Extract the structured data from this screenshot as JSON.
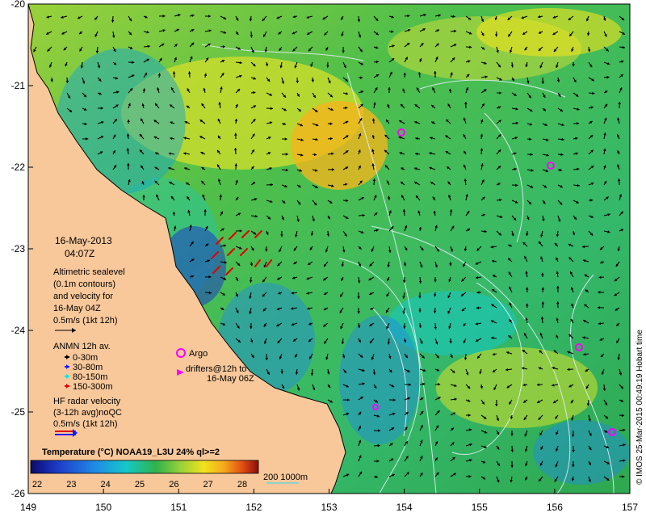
{
  "map": {
    "x_ticks": [
      "149",
      "150",
      "151",
      "152",
      "153",
      "154",
      "155",
      "156",
      "157"
    ],
    "y_ticks": [
      "-20",
      "-21",
      "-22",
      "-23",
      "-24",
      "-25",
      "-26"
    ],
    "timestamp": {
      "date": "16-May-2013",
      "time": "04:07Z"
    },
    "altimetry_text": [
      "Altimetric sealevel",
      "(0.1m contours)",
      "and velocity for",
      "16-May 04Z"
    ],
    "altimetry_scale": "0.5m/s (1kt 12h)",
    "anmn": {
      "title": "ANMN 12h av.",
      "items": [
        {
          "label": "0-30m",
          "color": "#000000"
        },
        {
          "label": "30-80m",
          "color": "#1a1aff"
        },
        {
          "label": "80-150m",
          "color": "#00e5e5"
        },
        {
          "label": "150-300m",
          "color": "#e60000"
        }
      ]
    },
    "argo_label": "Argo",
    "drifters_text": [
      "drifters@12h to",
      "16-May 06Z"
    ],
    "hf_text": [
      "HF radar velocity",
      "(3-12h avg)noQC",
      "0.5m/s (1kt 12h)"
    ],
    "colorbar_title": "Temperature (°C) NOAA19_L3U 24% ql>=2",
    "colorbar_ticks": [
      "22",
      "23",
      "24",
      "25",
      "26",
      "27",
      "28"
    ],
    "colorbar_colors": [
      "#0a0a6e",
      "#1d3cc9",
      "#1f8ae6",
      "#16c8c8",
      "#2fb34a",
      "#9ad13a",
      "#f2e21d",
      "#f5a81c",
      "#e24d13",
      "#8a0e0e"
    ],
    "bathymetry_label": "200  1000m",
    "credit": "© IMOS 25-Mar-2015 00:49:19 Hobart time",
    "colors": {
      "land": "#f8c89a",
      "contour": "#e8f0ff",
      "argo": "#ff00ff"
    }
  }
}
